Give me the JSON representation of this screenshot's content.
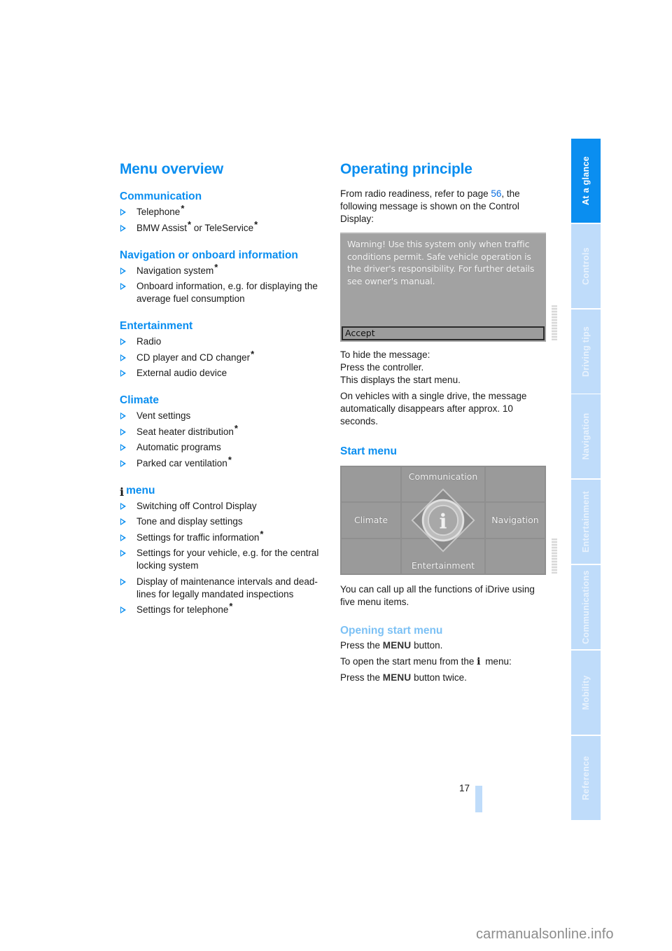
{
  "left": {
    "title": "Menu overview",
    "sections": [
      {
        "heading": "Communication",
        "items": [
          {
            "parts": [
              "Telephone"
            ],
            "stars": [
              true
            ]
          },
          {
            "parts": [
              "BMW Assist",
              " or TeleService"
            ],
            "stars": [
              true,
              true
            ]
          }
        ]
      },
      {
        "heading": "Navigation or onboard information",
        "items": [
          {
            "parts": [
              "Navigation system"
            ],
            "stars": [
              true
            ]
          },
          {
            "parts": [
              "Onboard information, e.g. for displaying the average fuel consumption"
            ],
            "stars": [
              false
            ]
          }
        ]
      },
      {
        "heading": "Entertainment",
        "items": [
          {
            "parts": [
              "Radio"
            ],
            "stars": [
              false
            ]
          },
          {
            "parts": [
              "CD player and CD changer"
            ],
            "stars": [
              true
            ]
          },
          {
            "parts": [
              "External audio device"
            ],
            "stars": [
              false
            ]
          }
        ]
      },
      {
        "heading": "Climate",
        "items": [
          {
            "parts": [
              "Vent settings"
            ],
            "stars": [
              false
            ]
          },
          {
            "parts": [
              "Seat heater distribution"
            ],
            "stars": [
              true
            ]
          },
          {
            "parts": [
              "Automatic programs"
            ],
            "stars": [
              false
            ]
          },
          {
            "parts": [
              "Parked car ventilation"
            ],
            "stars": [
              true
            ]
          }
        ]
      },
      {
        "heading": "menu",
        "heading_icon": "info-i-icon",
        "items": [
          {
            "parts": [
              "Switching off Control Display"
            ],
            "stars": [
              false
            ]
          },
          {
            "parts": [
              "Tone and display settings"
            ],
            "stars": [
              false
            ]
          },
          {
            "parts": [
              "Settings for traffic information"
            ],
            "stars": [
              true
            ]
          },
          {
            "parts": [
              "Settings for your vehicle, e.g. for the central locking system"
            ],
            "stars": [
              false
            ]
          },
          {
            "parts": [
              "Display of maintenance intervals and dead-lines for legally mandated inspections"
            ],
            "stars": [
              false
            ]
          },
          {
            "parts": [
              "Settings for telephone"
            ],
            "stars": [
              true
            ]
          }
        ]
      }
    ],
    "star_glyph": "*",
    "info_glyph": "i"
  },
  "right": {
    "title": "Operating principle",
    "intro_before": "From radio readiness, refer to page ",
    "intro_link": "56",
    "intro_after": ", the following message is shown on the Control Display:",
    "warning_screen": {
      "message": "Warning! Use this system only when traffic conditions permit. Safe vehicle operation is the driver's responsibility. For further details see owner's manual.",
      "accept_label": "Accept"
    },
    "hide_line1": "To hide the message:",
    "hide_line2": "Press the controller.",
    "hide_line3": "This displays the start menu.",
    "single_drive": "On vehicles with a single drive, the message automatically disappears after approx. 10 seconds.",
    "start_menu_heading": "Start menu",
    "start_screen": {
      "top": "Communication",
      "left": "Climate",
      "right": "Navigation",
      "bottom": "Entertainment",
      "center_icon": "i"
    },
    "call_up": "You can call up all the functions of iDrive using five menu items.",
    "opening_heading": "Opening start menu",
    "press_before": "Press the ",
    "menu_key": "MENU",
    "press_after": " button.",
    "open_from_before": "To open the start menu from the ",
    "open_from_after": " menu:",
    "press_twice_after": " button twice."
  },
  "side_tabs": [
    {
      "label": "At a glance",
      "active": true
    },
    {
      "label": "Controls",
      "active": false
    },
    {
      "label": "Driving tips",
      "active": false
    },
    {
      "label": "Navigation",
      "active": false
    },
    {
      "label": "Entertainment",
      "active": false
    },
    {
      "label": "Communications",
      "active": false
    },
    {
      "label": "Mobility",
      "active": false
    },
    {
      "label": "Reference",
      "active": false
    }
  ],
  "page_number": "17",
  "watermark": "carmanualsonline.info",
  "colors": {
    "accent": "#0a8ef0",
    "tab_inactive": "#bfdcfa",
    "screen_gray": "#a2a2a2"
  }
}
